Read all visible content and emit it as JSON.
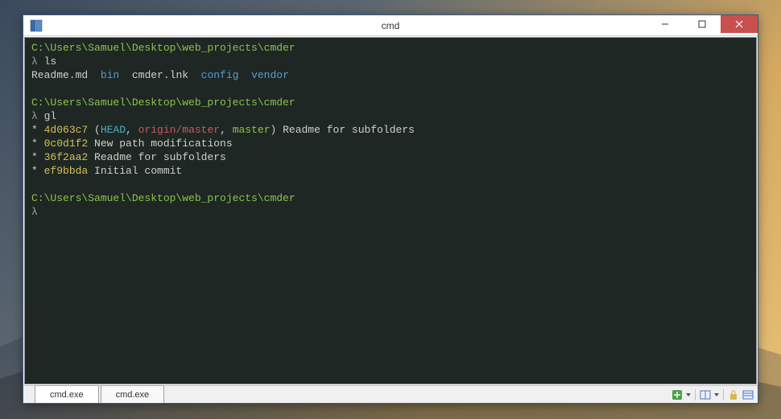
{
  "window": {
    "title": "cmd"
  },
  "terminal": {
    "lines": [
      {
        "spans": [
          {
            "cls": "c-green",
            "t": "C:\\Users\\Samuel\\Desktop\\web_projects\\cmder"
          }
        ]
      },
      {
        "spans": [
          {
            "cls": "c-grey",
            "t": "λ "
          },
          {
            "cls": "c-fg",
            "t": "ls"
          }
        ]
      },
      {
        "spans": [
          {
            "cls": "c-fg",
            "t": "Readme.md  "
          },
          {
            "cls": "c-blue",
            "t": "bin"
          },
          {
            "cls": "c-fg",
            "t": "  cmder.lnk  "
          },
          {
            "cls": "c-blue",
            "t": "config"
          },
          {
            "cls": "c-fg",
            "t": "  "
          },
          {
            "cls": "c-blue",
            "t": "vendor"
          }
        ]
      },
      {
        "spans": [
          {
            "cls": "c-fg",
            "t": ""
          }
        ]
      },
      {
        "spans": [
          {
            "cls": "c-green",
            "t": "C:\\Users\\Samuel\\Desktop\\web_projects\\cmder"
          }
        ]
      },
      {
        "spans": [
          {
            "cls": "c-grey",
            "t": "λ "
          },
          {
            "cls": "c-fg",
            "t": "gl"
          }
        ]
      },
      {
        "spans": [
          {
            "cls": "c-fg",
            "t": "* "
          },
          {
            "cls": "c-yellow",
            "t": "4d063c7"
          },
          {
            "cls": "c-fg",
            "t": " ("
          },
          {
            "cls": "c-cyan",
            "t": "HEAD"
          },
          {
            "cls": "c-fg",
            "t": ", "
          },
          {
            "cls": "c-red",
            "t": "origin/master"
          },
          {
            "cls": "c-fg",
            "t": ", "
          },
          {
            "cls": "c-green",
            "t": "master"
          },
          {
            "cls": "c-fg",
            "t": ") Readme for subfolders"
          }
        ]
      },
      {
        "spans": [
          {
            "cls": "c-fg",
            "t": "* "
          },
          {
            "cls": "c-yellow",
            "t": "0c0d1f2"
          },
          {
            "cls": "c-fg",
            "t": " New path modifications"
          }
        ]
      },
      {
        "spans": [
          {
            "cls": "c-fg",
            "t": "* "
          },
          {
            "cls": "c-yellow",
            "t": "36f2aa2"
          },
          {
            "cls": "c-fg",
            "t": " Readme for subfolders"
          }
        ]
      },
      {
        "spans": [
          {
            "cls": "c-fg",
            "t": "* "
          },
          {
            "cls": "c-yellow",
            "t": "ef9bbda"
          },
          {
            "cls": "c-fg",
            "t": " Initial commit"
          }
        ]
      },
      {
        "spans": [
          {
            "cls": "c-fg",
            "t": ""
          }
        ]
      },
      {
        "spans": [
          {
            "cls": "c-green",
            "t": "C:\\Users\\Samuel\\Desktop\\web_projects\\cmder"
          }
        ]
      },
      {
        "spans": [
          {
            "cls": "c-grey",
            "t": "λ"
          }
        ]
      }
    ]
  },
  "tabs": [
    {
      "label": "cmd.exe",
      "active": true
    },
    {
      "label": "cmd.exe",
      "active": false
    }
  ],
  "status_icons": {
    "add": "add-tab-icon",
    "dropdown": "dropdown-icon",
    "split": "split-icon",
    "lock": "lock-icon",
    "menu": "menu-icon"
  }
}
